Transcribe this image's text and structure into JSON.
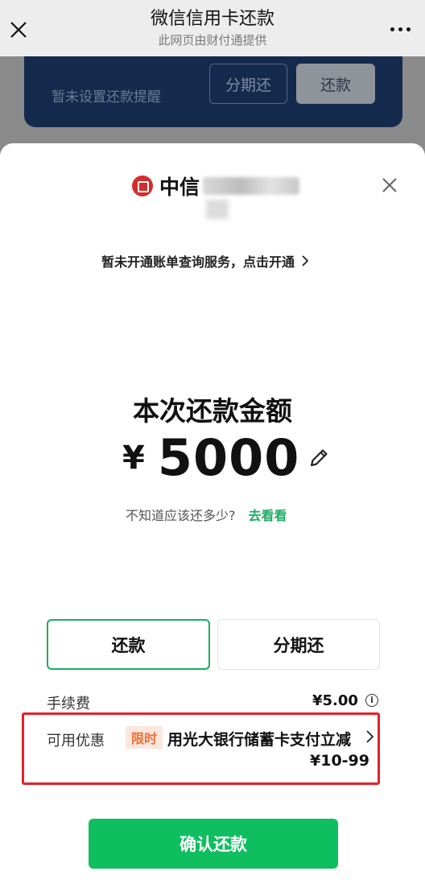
{
  "header": {
    "title": "微信信用卡还款",
    "subtitle": "此网页由财付通提供"
  },
  "background": {
    "reminder": "暂未设置还款提醒",
    "installment_button": "分期还",
    "repay_button": "还款"
  },
  "sheet": {
    "bank_name": "中信",
    "open_service": "暂未开通账单查询服务，点击开通",
    "amount_title": "本次还款金额",
    "currency": "¥",
    "amount": "5000",
    "hint": "不知道应该还多少?",
    "hint_link": "去看看",
    "tabs": [
      {
        "label": "还款",
        "selected": true
      },
      {
        "label": "分期还",
        "selected": false
      }
    ],
    "fee_label": "手续费",
    "fee_value": "¥5.00",
    "promo_label": "可用优惠",
    "promo_badge": "限时",
    "promo_text": "用光大银行储蓄卡支付立减",
    "promo_amount": "¥10-99",
    "confirm_button": "确认还款"
  },
  "colors": {
    "accent_green": "#0fbe5e",
    "highlight_red": "#e8202a",
    "badge_orange": "#f06c35",
    "bank_red": "#d22e2e"
  }
}
